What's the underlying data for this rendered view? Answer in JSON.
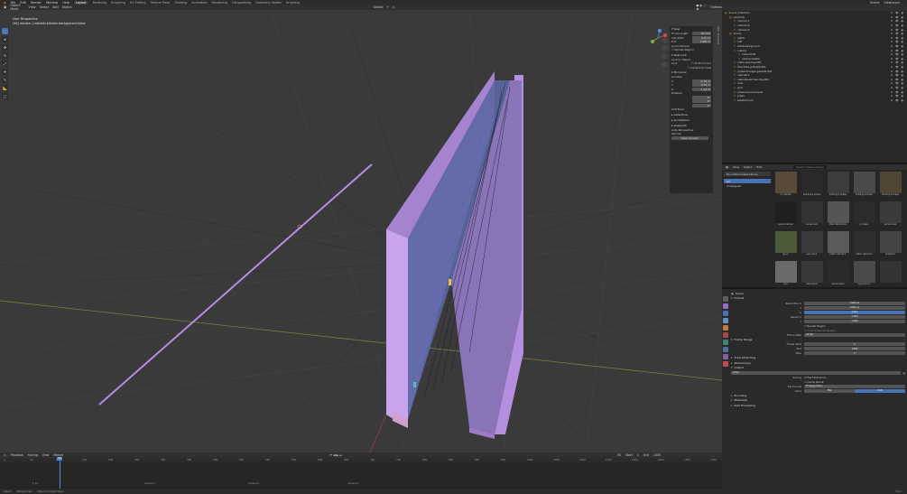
{
  "topbar": {
    "menus": [
      "File",
      "Edit",
      "Render",
      "Window",
      "Help"
    ],
    "workspaces": [
      "Layout",
      "Modeling",
      "Sculpting",
      "UV Editing",
      "Texture Paint",
      "Shading",
      "Animation",
      "Rendering",
      "Compositing",
      "Geometry Nodes",
      "Scripting"
    ],
    "scene": "Scene",
    "view_layer": "ViewLayer"
  },
  "viewport_header": {
    "mode": "Object Mode",
    "menus": [
      "View",
      "Select",
      "Add",
      "Object"
    ],
    "orientation": "Global",
    "options": "Options"
  },
  "overlay_text": {
    "line1": "User Perspective",
    "line2": "(50) remote | cabinets.kitchen.background.turbo"
  },
  "tools": [
    "select-icon",
    "cursor-icon",
    "move-icon",
    "rotate-icon",
    "scale-icon",
    "transform-icon",
    "annotate-icon",
    "measure-icon",
    "add-cube-icon"
  ],
  "npanel": {
    "tabs": [
      "Item",
      "Tool",
      "View"
    ],
    "view_section": "View",
    "focal_label": "Focal Length",
    "focal_value": "50 mm",
    "clip_start_label": "Clip Start",
    "clip_start_value": "0.01 m",
    "clip_end_label": "End",
    "clip_end_value": "1000 m",
    "local_camera_label": "Local Camera",
    "render_region_label": "Render Region",
    "view_lock_label": "View Lock",
    "lock_to_object_label": "Lock to Object",
    "lock_label": "Lock",
    "to_3d_cursor": "To 3D Cursor",
    "camera_to_view": "Camera to View",
    "cursor_section": "3D Cursor",
    "location_label": "Location",
    "x_label": "X",
    "x_value": "-1.75 m",
    "y_label": "Y",
    "y_value": "-3.31 m",
    "z_label": "Z",
    "z_value": "1.12 m",
    "rotation_label": "Rotation",
    "rx_value": "0°",
    "ry_value": "0°",
    "rz_value": "0°",
    "rot_mode": "XYZ Euler",
    "collections_section": "Collections",
    "annotations_section": "Annotations",
    "viewpoint_section": "Viewpoint",
    "auto_perspective": "Auto Perspective",
    "set_bg": "Set cell",
    "view_current": "View Current"
  },
  "timeline": {
    "menus": [
      "Playback",
      "Keying",
      "View",
      "Marker"
    ],
    "current_frame": "50",
    "start_label": "Start",
    "start_value": "1",
    "end_label": "End",
    "end_value": "2400",
    "ticks": [
      "0",
      "50",
      "100",
      "150",
      "200",
      "250",
      "300",
      "350",
      "400",
      "450",
      "500",
      "550",
      "600",
      "650",
      "700",
      "750",
      "800",
      "850",
      "900",
      "950",
      "1000",
      "1050",
      "1100",
      "1150",
      "1200",
      "1250",
      "1300",
      "1350"
    ],
    "markers": [
      "F_01",
      "camera.1",
      "camera.2",
      "camera.3"
    ]
  },
  "statusbar": {
    "left": [
      "Select",
      "Rotate View",
      "Object Context Menu"
    ],
    "right": "3.6.2"
  },
  "outliner": {
    "title": "Scene Collection",
    "rows": [
      {
        "label": "Scene Collection",
        "indent": 0
      },
      {
        "label": "Cameras",
        "indent": 1
      },
      {
        "label": "camera.1",
        "indent": 2
      },
      {
        "label": "camera.2",
        "indent": 2
      },
      {
        "label": "camera.3",
        "indent": 2
      },
      {
        "label": "Scene",
        "indent": 1
      },
      {
        "label": "lights",
        "indent": 2
      },
      {
        "label": "hall",
        "indent": 2
      },
      {
        "label": "walls.background",
        "indent": 2
      },
      {
        "label": "cubicle",
        "indent": 2
      },
      {
        "label": "racked.left",
        "indent": 3
      },
      {
        "label": "racked.shelter",
        "indent": 3
      },
      {
        "label": "cable.rack.bay.001",
        "indent": 2
      },
      {
        "label": "floor.tiles.gridlight.001",
        "indent": 2
      },
      {
        "label": "grates.triangle.gaskets.001",
        "indent": 2
      },
      {
        "label": "cabinet.1",
        "indent": 2
      },
      {
        "label": "cabinets.kitchen.bay.001",
        "indent": 2
      },
      {
        "label": "rails",
        "indent": 2
      },
      {
        "label": "grid",
        "indent": 2
      },
      {
        "label": "power.box.sm.panel",
        "indent": 2
      },
      {
        "label": "pipes",
        "indent": 2
      },
      {
        "label": "walkthrough",
        "indent": 2
      }
    ]
  },
  "asset_browser": {
    "menus": [
      "View",
      "Select",
      "Edit"
    ],
    "library": "My Custom Asset Library",
    "search": "Search Asset Library",
    "categories": [
      "All",
      "Unassigned"
    ],
    "assets": [
      "pc.cabinet",
      "building.2.shape",
      "building.3.shape",
      "building.4.shape",
      "building.5.shape",
      "server.cabinet",
      "server.rack",
      "data.cabinet.box",
      "pc.tower",
      "server.desk",
      "gpu.1",
      "sub.rack.1",
      "patch.cabinet.1",
      "patch.cabinet.2",
      "keyboard",
      "psu",
      "cable.spool",
      "server.tower",
      "hypervisor.1",
      ""
    ]
  },
  "properties": {
    "title": "Scene",
    "format_section": "Format",
    "res_x_label": "Resolution X",
    "res_x_value": "1920 px",
    "res_y_label": "Y",
    "res_y_value": "1080 px",
    "res_pct_label": "%",
    "res_pct_value": "100%",
    "aspect_x_label": "Aspect X",
    "aspect_x_value": "1.000",
    "aspect_y_label": "Y",
    "aspect_y_value": "1.000",
    "render_region": "Render Region",
    "crop_region": "Crop to Render Region",
    "frame_rate_label": "Frame Rate",
    "frame_rate_value": "24 fps",
    "frame_range_section": "Frame Range",
    "frame_start_label": "Frame Start",
    "frame_start_value": "1",
    "end_label": "End",
    "end_value": "2400",
    "step_label": "Step",
    "step_value": "1",
    "time_stretching": "Time Stretching",
    "stereoscopy": "Stereoscopy",
    "output_section": "Output",
    "output_path": "/tmp/",
    "saving_label": "Saving",
    "file_extensions": "File Extensions",
    "cache_result": "Cache Result",
    "file_format_label": "File Format",
    "file_format_value": "FFmpeg Video",
    "color_label": "Color",
    "bw": "BW",
    "rgb": "RGB",
    "encoding_section": "Encoding",
    "metadata_section": "Metadata",
    "post_processing_section": "Post Processing"
  },
  "colors": {
    "accent": "#4772b3",
    "object_purple": "#b48de6",
    "viewport_bg": "#3a3a3a"
  }
}
